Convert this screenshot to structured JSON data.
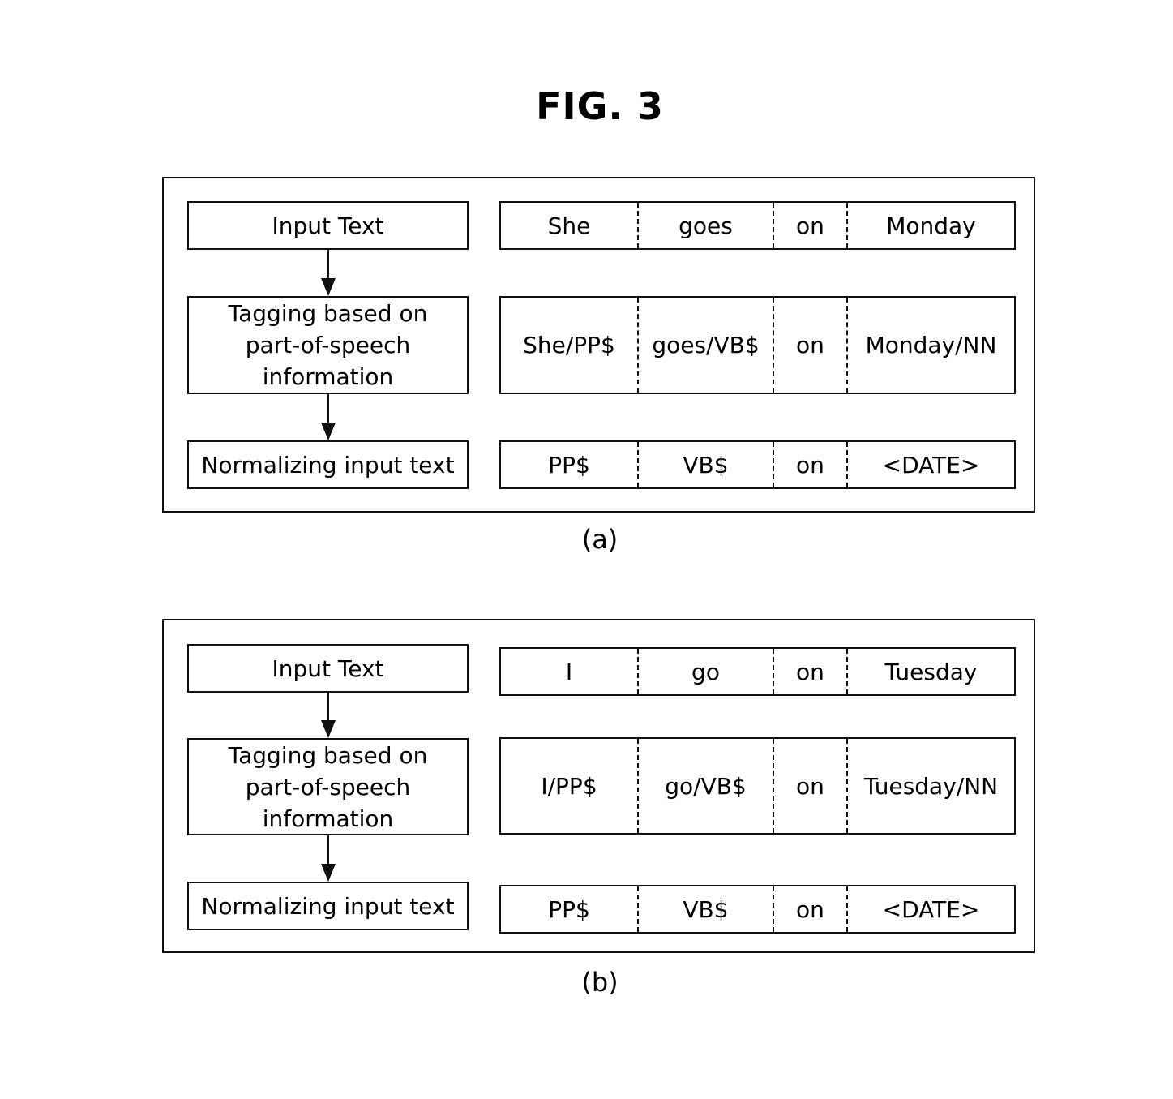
{
  "figure": {
    "title": "FIG. 3"
  },
  "panels": [
    {
      "label": "(a)",
      "steps": [
        "Input Text",
        "Tagging based on part-of-speech information",
        "Normalizing input text"
      ],
      "rows": [
        [
          "She",
          "goes",
          "on",
          "Monday"
        ],
        [
          "She/PP$",
          "goes/VB$",
          "on",
          "Monday/NN"
        ],
        [
          "PP$",
          "VB$",
          "on",
          "<DATE>"
        ]
      ]
    },
    {
      "label": "(b)",
      "steps": [
        "Input Text",
        "Tagging based on part-of-speech information",
        "Normalizing input text"
      ],
      "rows": [
        [
          "I",
          "go",
          "on",
          "Tuesday"
        ],
        [
          "I/PP$",
          "go/VB$",
          "on",
          "Tuesday/NN"
        ],
        [
          "PP$",
          "VB$",
          "on",
          "<DATE>"
        ]
      ]
    }
  ]
}
